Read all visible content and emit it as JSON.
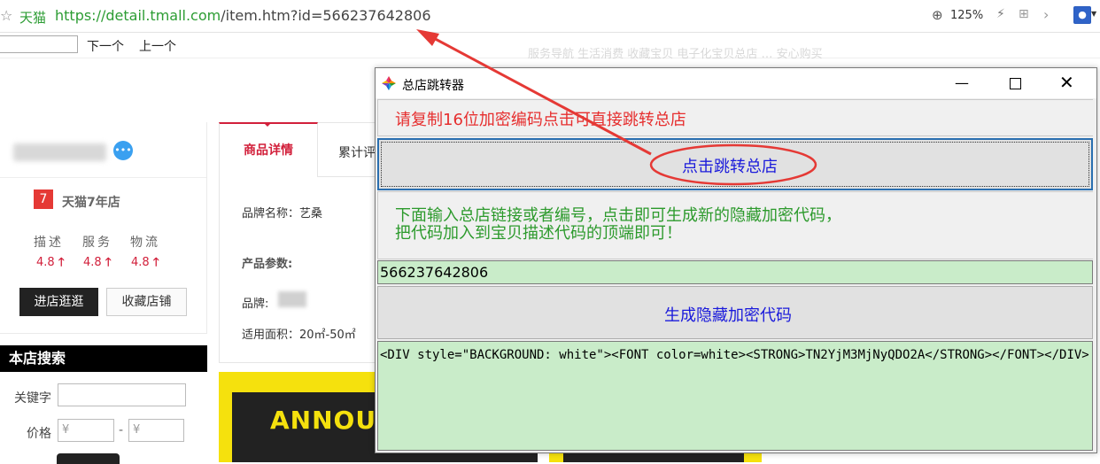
{
  "browser": {
    "site_name": "天猫",
    "url_prefix": "https://",
    "url_host": "detail.tmall.com",
    "url_rest": "/item.htm?id=566237642806",
    "zoom": "125%",
    "find_next": "下一个",
    "find_prev": "上一个"
  },
  "page": {
    "topnav": "服务导航  生活消费  收藏宝贝  电子化宝贝总店  …    安心购买",
    "shop": {
      "tmall_badge": "7",
      "tmall_years": "天猫7年店",
      "ratings": [
        {
          "label": "描述",
          "value": "4.8"
        },
        {
          "label": "服务",
          "value": "4.8"
        },
        {
          "label": "物流",
          "value": "4.8"
        }
      ],
      "enter_button": "进店逛逛",
      "favorite_button": "收藏店铺"
    },
    "search": {
      "heading": "本店搜索",
      "keyword_label": "关键字",
      "price_label": "价格",
      "price_min_placeholder": "¥",
      "price_max_placeholder": "¥",
      "dash": "-"
    },
    "tabs": {
      "active": "商品详情",
      "other": "累计评"
    },
    "attributes": {
      "brand_name": "品牌名称：艺桑",
      "params_heading": "产品参数:",
      "brand": "品牌:",
      "area": "适用面积：20㎡-50㎡"
    },
    "banner_text": "ANNOUNC"
  },
  "dialog": {
    "title": "总店跳转器",
    "copy_hint": "请复制16位加密编码点击可直接跳转总店",
    "jump_button": "点击跳转总店",
    "hint_line1": "下面输入总店链接或者编号，点击即可生成新的隐藏加密代码，",
    "hint_line2": "把代码加入到宝贝描述代码的顶端即可！",
    "id_value": "566237642806",
    "generate_button": "生成隐藏加密代码",
    "code_output": "<DIV style=\"BACKGROUND: white\"><FONT color=white><STRONG>TN2YjM3MjNyQDO2A</STRONG></FONT></DIV>",
    "colors": {
      "red_text": "#e62e2e",
      "blue_text": "#1a1adb",
      "green_text": "#2c9a2c",
      "green_field": "#c9ecc9"
    }
  },
  "annotation": {
    "color": "#e53935"
  }
}
